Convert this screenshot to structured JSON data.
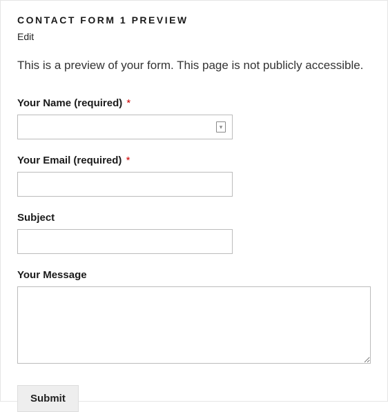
{
  "header": {
    "title": "CONTACT FORM 1 PREVIEW",
    "edit_label": "Edit"
  },
  "notice": "This is a preview of your form. This page is not publicly accessible.",
  "fields": {
    "name": {
      "label": "Your Name (required)",
      "required_mark": "*",
      "value": ""
    },
    "email": {
      "label": "Your Email (required)",
      "required_mark": "*",
      "value": ""
    },
    "subject": {
      "label": "Subject",
      "value": ""
    },
    "message": {
      "label": "Your Message",
      "value": ""
    }
  },
  "submit": {
    "label": "Submit"
  },
  "icons": {
    "autofill": "autofill-contact-icon"
  }
}
